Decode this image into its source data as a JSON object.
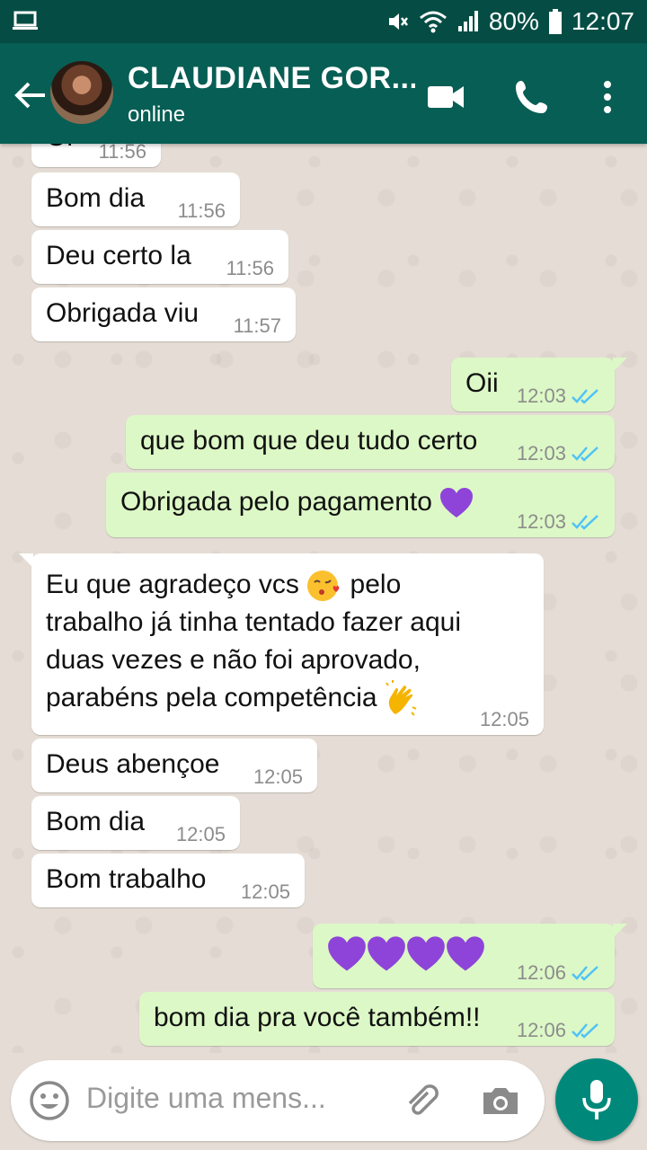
{
  "status_bar": {
    "battery": "80%",
    "time": "12:07"
  },
  "header": {
    "contact_name": "CLAUDIANE GOR...",
    "contact_status": "online"
  },
  "messages": [
    {
      "dir": "in",
      "text": "Oi",
      "time": "11:56"
    },
    {
      "dir": "in",
      "text": "Bom dia",
      "time": "11:56"
    },
    {
      "dir": "in",
      "text": "Deu certo la",
      "time": "11:56"
    },
    {
      "dir": "in",
      "text": "Obrigada viu",
      "time": "11:57"
    },
    {
      "dir": "out",
      "text": "Oii",
      "time": "12:03"
    },
    {
      "dir": "out",
      "text": "que bom que deu tudo certo",
      "time": "12:03"
    },
    {
      "dir": "out",
      "text": "Obrigada pelo pagamento",
      "time": "12:03",
      "emoji": "purple-heart"
    },
    {
      "dir": "in",
      "line1": "Eu que agradeço vcs",
      "line1b": "pelo",
      "line2": "trabalho já tinha tentado fazer aqui",
      "line3": "duas vezes e não foi aprovado,",
      "line4": "parabéns pela competência",
      "time": "12:05",
      "emoji1": "kissing-face-with-heart",
      "emoji2": "clapping-hands"
    },
    {
      "dir": "in",
      "text": "Deus abençoe",
      "time": "12:05"
    },
    {
      "dir": "in",
      "text": "Bom dia",
      "time": "12:05"
    },
    {
      "dir": "in",
      "text": "Bom trabalho",
      "time": "12:05"
    },
    {
      "dir": "out",
      "text": "",
      "time": "12:06",
      "emoji": "purple-heart x4"
    },
    {
      "dir": "out",
      "text": "bom dia pra você também!!",
      "time": "12:06"
    }
  ],
  "input": {
    "placeholder": "Digite uma mens..."
  },
  "colors": {
    "header": "#075e54",
    "statusbar": "#054d44",
    "outgoing": "#dcf8c6",
    "incoming": "#ffffff",
    "mic": "#00897b",
    "read_ticks": "#4fc3f7"
  }
}
